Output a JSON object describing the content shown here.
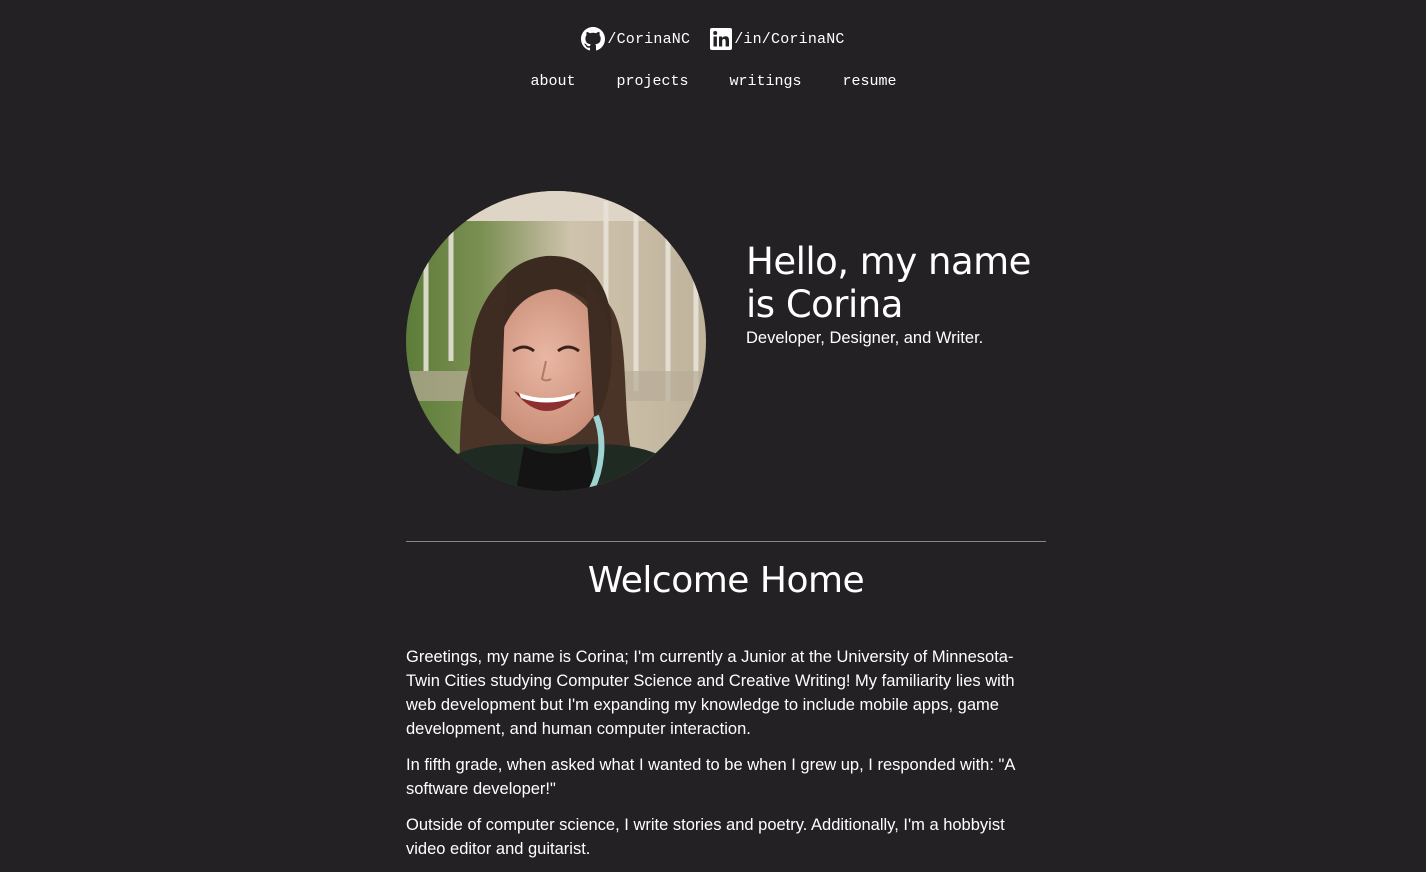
{
  "social": {
    "github": {
      "icon": "github-icon",
      "label": "/CorinaNC"
    },
    "linkedin": {
      "icon": "linkedin-icon",
      "label": "/in/CorinaNC"
    }
  },
  "nav": {
    "items": [
      {
        "label": "about"
      },
      {
        "label": "projects"
      },
      {
        "label": "writings"
      },
      {
        "label": "resume"
      }
    ]
  },
  "hero": {
    "title": "Hello, my name is Corina",
    "subtitle": "Developer, Designer, and Writer."
  },
  "welcome": {
    "heading": "Welcome Home",
    "paragraphs": [
      "Greetings, my name is Corina; I'm currently a Junior at the University of Minnesota-Twin Cities studying Computer Science and Creative Writing! My familiarity lies with web development but I'm expanding my knowledge to include mobile apps, game development, and human computer interaction.",
      "In fifth grade, when asked what I wanted to be when I grew up, I responded with: \"A software developer!\"",
      "Outside of computer science, I write stories and poetry. Additionally, I'm a hobbyist video editor and guitarist."
    ]
  },
  "colors": {
    "background": "#242124",
    "text": "#ffffff",
    "divider": "#8a8589"
  }
}
